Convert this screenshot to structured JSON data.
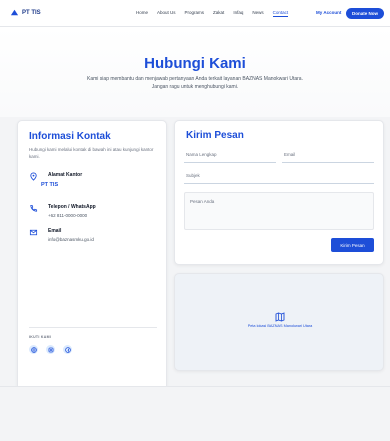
{
  "brand": {
    "name": "PT TIS",
    "color": "#1d4ed8"
  },
  "nav": {
    "links": [
      {
        "label": "Home"
      },
      {
        "label": "About Us"
      },
      {
        "label": "Programs"
      },
      {
        "label": "Zakat"
      },
      {
        "label": "Infaq"
      },
      {
        "label": "News"
      },
      {
        "label": "Contact",
        "active": true
      }
    ],
    "my_account": "My Account",
    "donate": "Donate Now"
  },
  "hero": {
    "title": "Hubungi Kami",
    "subtitle": "Kami siap membantu dan menjawab pertanyaan Anda terkait layanan BAZNAS Manokwari Utara. Jangan ragu untuk menghubungi kami."
  },
  "contact_info": {
    "title": "Informasi Kontak",
    "subtitle": "Hubungi kami melalui kontak di bawah ini atau kunjungi kantor kami.",
    "office": {
      "label": "Alamat Kantor",
      "value": "PT TIS"
    },
    "phone": {
      "label": "Telepon / WhatsApp",
      "value": "+62 811-0000-0000"
    },
    "email": {
      "label": "Email",
      "value": "info@baznasmku.go.id"
    },
    "follow_label": "IKUTI KAMI",
    "socials": [
      "globe-icon",
      "instagram-icon",
      "facebook-icon"
    ]
  },
  "form": {
    "title": "Kirim Pesan",
    "name_placeholder": "Nama Lengkap",
    "email_placeholder": "Email",
    "subject_placeholder": "Subjek",
    "message_placeholder": "Pesan Anda",
    "submit": "Kirim Pesan"
  },
  "map": {
    "label": "Peta lokasi BAZNAS Manokwari Utara",
    "icon": "map-icon"
  }
}
